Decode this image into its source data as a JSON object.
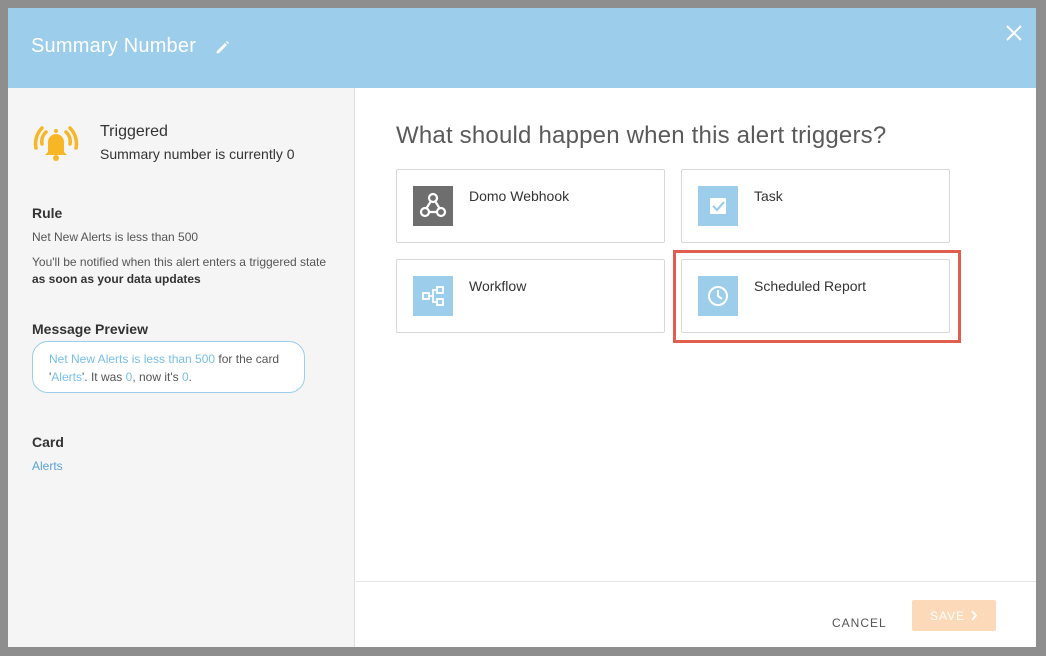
{
  "header": {
    "title": "Summary Number",
    "edit_icon": "pencil-icon",
    "close_icon": "close-icon"
  },
  "status": {
    "icon": "alarm-bell-icon",
    "title": "Triggered",
    "subtitle": "Summary number is currently 0"
  },
  "rule": {
    "heading": "Rule",
    "text": "Net New Alerts is less than 500",
    "notify_prefix": "You'll be notified when this alert enters a triggered state",
    "notify_bold": "as soon as your data updates"
  },
  "message_preview": {
    "heading": "Message Preview",
    "part1": "Net New Alerts is less than 500",
    "part2": " for the card '",
    "part3": "Alerts",
    "part4": "'. It was ",
    "part5": "0",
    "part6": ", now it's ",
    "part7": "0",
    "part8": "."
  },
  "card": {
    "heading": "Card",
    "link": "Alerts"
  },
  "main": {
    "question": "What should happen when this alert triggers?",
    "actions": [
      {
        "label": "Domo Webhook",
        "icon": "webhook-icon"
      },
      {
        "label": "Task",
        "icon": "task-checkbox-icon"
      },
      {
        "label": "Workflow",
        "icon": "workflow-icon"
      },
      {
        "label": "Scheduled Report",
        "icon": "clock-icon"
      }
    ]
  },
  "footer": {
    "cancel_label": "CANCEL",
    "save_label": "SAVE"
  },
  "colors": {
    "header": "#9ccdeb",
    "accent_link": "#5aa2d6",
    "highlight_box": "#e05e4e",
    "save_disabled": "#fcd9b8",
    "bell": "#f6b625"
  }
}
